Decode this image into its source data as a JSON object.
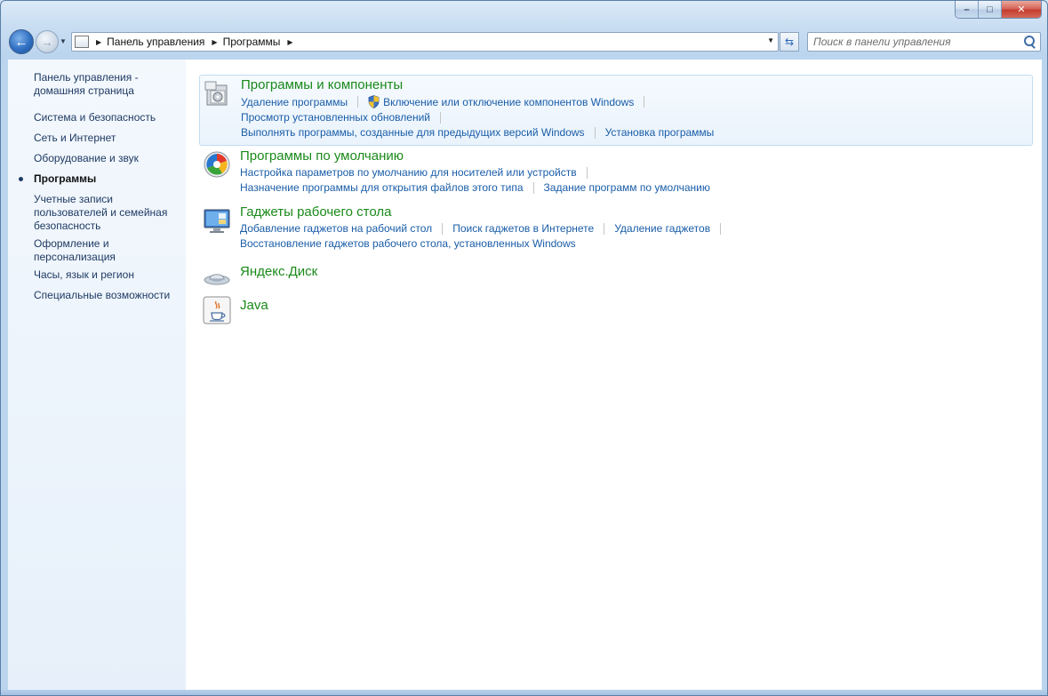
{
  "window": {
    "minimize_glyph": "–",
    "maximize_glyph": "□",
    "close_glyph": "✕"
  },
  "nav": {
    "back_glyph": "←",
    "forward_glyph": "→",
    "recent_glyph": "▼",
    "breadcrumb": [
      "Панель управления",
      "Программы"
    ],
    "crumb_separator": "▶",
    "dropdown_glyph": "▼",
    "refresh_glyph": "⇆",
    "search_placeholder": "Поиск в панели управления"
  },
  "sidebar": {
    "items": [
      {
        "label": "Панель управления - домашняя страница",
        "active": false
      },
      {
        "label": "Система и безопасность",
        "active": false
      },
      {
        "label": "Сеть и Интернет",
        "active": false
      },
      {
        "label": "Оборудование и звук",
        "active": false
      },
      {
        "label": "Программы",
        "active": true
      },
      {
        "label": "Учетные записи пользователей и семейная безопасность",
        "active": false
      },
      {
        "label": "Оформление и персонализация",
        "active": false
      },
      {
        "label": "Часы, язык и регион",
        "active": false
      },
      {
        "label": "Специальные возможности",
        "active": false
      }
    ]
  },
  "groups": [
    {
      "title": "Программы и компоненты",
      "icon": "programs-features-icon",
      "rows": [
        [
          "Удаление программы",
          "Включение или отключение компонентов Windows"
        ],
        [
          "Просмотр установленных обновлений"
        ],
        [
          "Выполнять программы, созданные для предыдущих версий Windows",
          "Установка программы"
        ]
      ]
    },
    {
      "title": "Программы по умолчанию",
      "icon": "default-programs-icon",
      "rows": [
        [
          "Настройка параметров по умолчанию для носителей или устройств"
        ],
        [
          "Назначение программы для открытия файлов этого типа",
          "Задание программ по умолчанию"
        ]
      ]
    },
    {
      "title": "Гаджеты рабочего стола",
      "icon": "desktop-gadgets-icon",
      "rows": [
        [
          "Добавление гаджетов на рабочий стол",
          "Поиск гаджетов в Интернете",
          "Удаление гаджетов"
        ],
        [
          "Восстановление гаджетов рабочего стола, установленных Windows"
        ]
      ]
    },
    {
      "title": "Яндекс.Диск",
      "icon": "yandex-disk-icon",
      "rows": []
    },
    {
      "title": "Java",
      "icon": "java-icon",
      "rows": []
    }
  ],
  "colors": {
    "title_green": "#1a8a1a",
    "link_blue": "#1a5da8",
    "sidebar_text": "#1f3a63"
  }
}
